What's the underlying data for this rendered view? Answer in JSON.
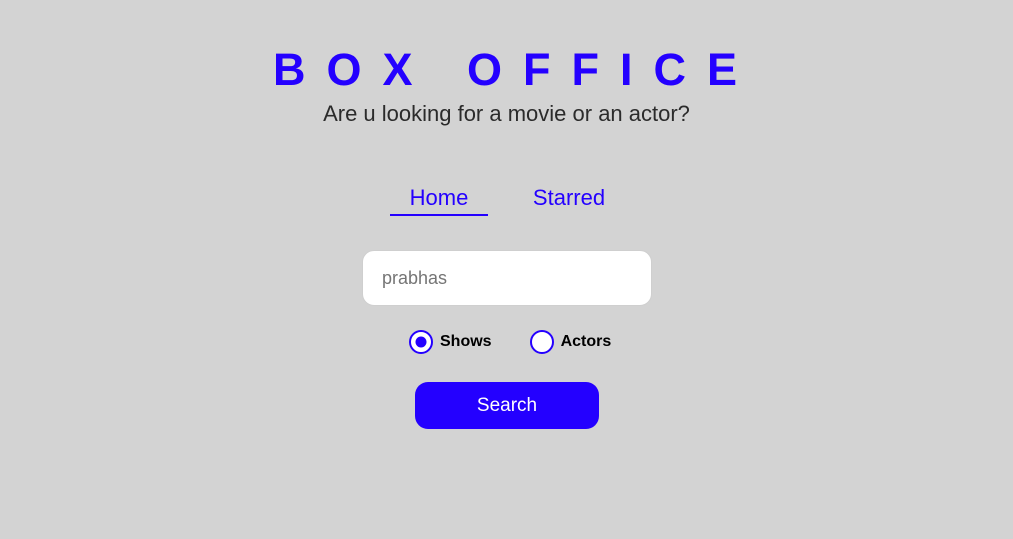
{
  "header": {
    "title": "BOX OFFICE",
    "subtitle": "Are u looking for a movie or an actor?"
  },
  "nav": {
    "items": [
      {
        "label": "Home",
        "active": true
      },
      {
        "label": "Starred",
        "active": false
      }
    ]
  },
  "search": {
    "value": "",
    "placeholder": "prabhas"
  },
  "search_type": {
    "options": [
      {
        "label": "Shows",
        "checked": true
      },
      {
        "label": "Actors",
        "checked": false
      }
    ]
  },
  "search_button": {
    "label": "Search"
  },
  "colors": {
    "accent": "#2400ff",
    "background": "#d3d3d3",
    "subtitle_text": "#2b2b2b"
  }
}
